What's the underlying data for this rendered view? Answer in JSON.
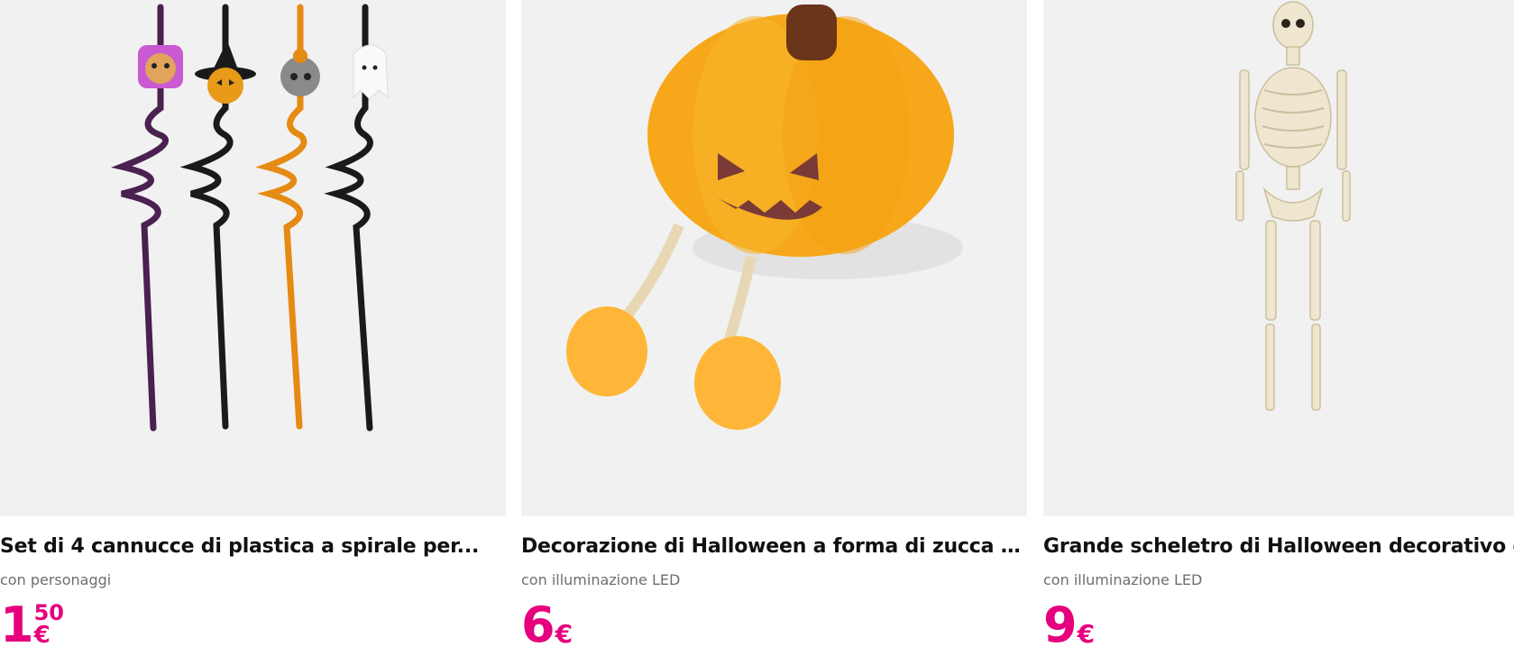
{
  "products": [
    {
      "title": "Set di 4 cannucce di plastica a spirale per...",
      "subtitle": "con personaggi",
      "price_int": "1",
      "price_dec": "50",
      "currency": "€",
      "image_icon": "spiral-straws-icon"
    },
    {
      "title": "Decorazione di Halloween a forma di zucca in...",
      "subtitle": "con illuminazione LED",
      "price_int": "6",
      "price_dec": "",
      "currency": "€",
      "image_icon": "pumpkin-icon"
    },
    {
      "title": "Grande scheletro di Halloween decorativo co...",
      "subtitle": "con illuminazione LED",
      "price_int": "9",
      "price_dec": "",
      "currency": "€",
      "image_icon": "skeleton-icon"
    }
  ],
  "colors": {
    "price": "#e6007e",
    "image_bg": "#f1f1f1",
    "title": "#111111",
    "subtitle": "#6e6e6e"
  }
}
